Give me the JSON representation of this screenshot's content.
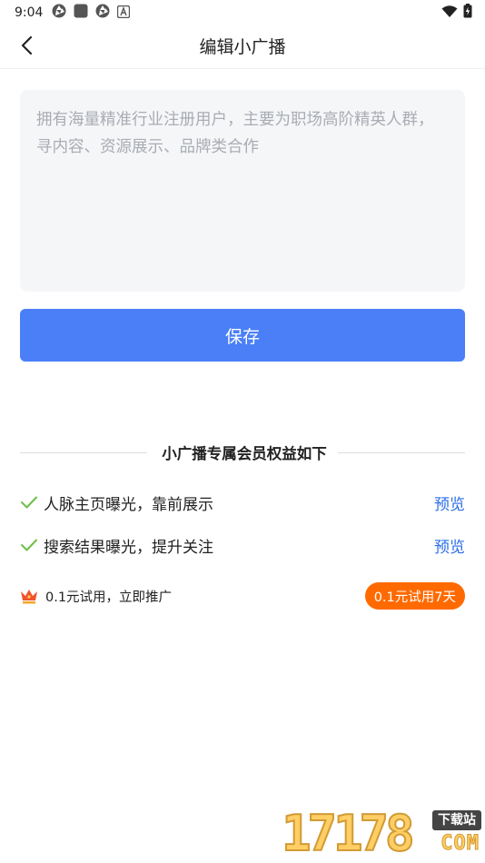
{
  "status_bar": {
    "time": "9:04",
    "left_icons": [
      "aperture-icon",
      "square-app-icon",
      "aperture-icon",
      "a-badge-icon"
    ],
    "right_icons": [
      "wifi-icon",
      "battery-charging-icon"
    ]
  },
  "header": {
    "back_icon": "chevron-left-icon",
    "title": "编辑小广播"
  },
  "editor": {
    "value": "",
    "placeholder": "拥有海量精准行业注册用户，主要为职场高阶精英人群，寻内容、资源展示、品牌类合作"
  },
  "save_label": "保存",
  "benefits": {
    "title": "小广播专属会员权益如下",
    "items": [
      {
        "text": "人脉主页曝光，靠前展示",
        "action": "预览"
      },
      {
        "text": "搜索结果曝光，提升关注",
        "action": "预览"
      }
    ]
  },
  "trial": {
    "text": "0.1元试用，立即推广",
    "button_label": "0.1元试用7天"
  },
  "watermark": {
    "digits": "17178",
    "tag": "下载站",
    "suffix": "COM"
  },
  "colors": {
    "primary_blue": "#4a7ff7",
    "link_blue": "#2b6de5",
    "check_green": "#6cc04a",
    "trial_orange": "#ff6a00",
    "textarea_bg": "#f5f6f8"
  }
}
